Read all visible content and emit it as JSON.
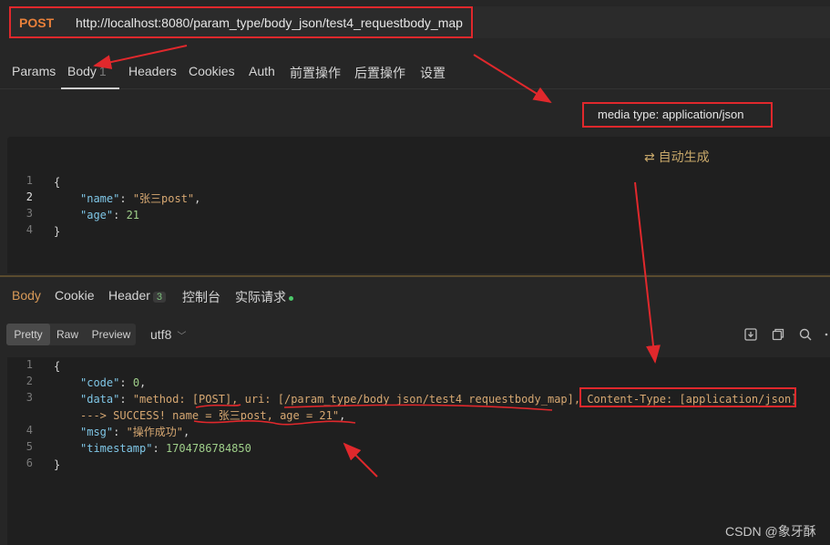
{
  "request": {
    "method": "POST",
    "url": "http://localhost:8080/param_type/body_json/test4_requestbody_map"
  },
  "request_tabs": [
    {
      "label": "Params"
    },
    {
      "label": "Body",
      "count": "1"
    },
    {
      "label": "Headers"
    },
    {
      "label": "Cookies"
    },
    {
      "label": "Auth"
    },
    {
      "label": "前置操作"
    },
    {
      "label": "后置操作"
    },
    {
      "label": "设置"
    }
  ],
  "annotation": {
    "media_type": "media type: application/json"
  },
  "request_body": {
    "auto_generate": "自动生成",
    "line_numbers": [
      "1",
      "2",
      "3",
      "4"
    ],
    "lines": {
      "l1": "{",
      "name_key": "\"name\"",
      "name_val": "\"张三post\"",
      "age_key": "\"age\"",
      "age_val": "21",
      "l4": "}"
    }
  },
  "response_tabs": [
    {
      "label": "Body"
    },
    {
      "label": "Cookie"
    },
    {
      "label": "Header",
      "count": "3"
    },
    {
      "label": "控制台"
    },
    {
      "label": "实际请求"
    }
  ],
  "view_modes": [
    "Pretty",
    "Raw",
    "Preview"
  ],
  "encoding": "utf8",
  "response_body": {
    "line_numbers": [
      "1",
      "2",
      "3",
      "",
      "4",
      "5",
      "6"
    ],
    "lines": {
      "l1": "{",
      "code_key": "\"code\"",
      "code_val": "0",
      "data_key": "\"data\"",
      "data_val_a": "\"method: [POST], uri: [/param_type/body_json/test4_requestbody_map], ",
      "data_val_b": "Content-Type: [application/json]",
      "data_val_c": "---> SUCCESS! name = 张三post, age = 21\"",
      "msg_key": "\"msg\"",
      "msg_val": "\"操作成功\"",
      "ts_key": "\"timestamp\"",
      "ts_val": "1704786784850",
      "l6": "}"
    }
  },
  "watermark": "CSDN @象牙酥",
  "colors": {
    "highlight_red": "#e0282c",
    "method_orange": "#e8803a",
    "active_tab": "#d89a58"
  }
}
